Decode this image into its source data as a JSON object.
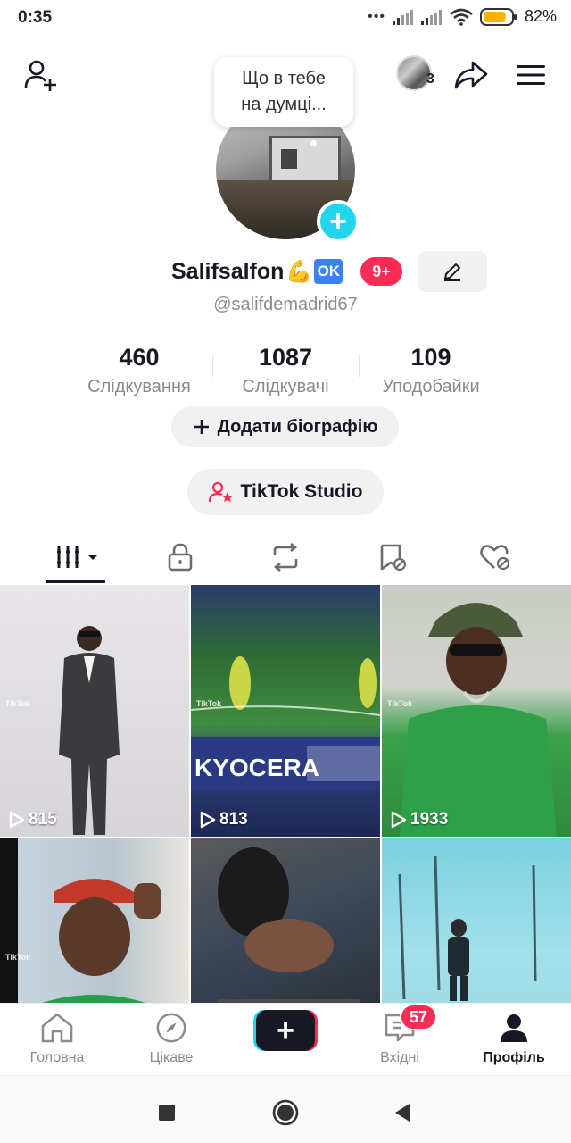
{
  "status_bar": {
    "time": "0:35",
    "battery_percent": "82%",
    "battery_level": 0.82,
    "icons": [
      "dots-icon",
      "signal-icon",
      "signal-icon",
      "wifi-icon",
      "battery-icon"
    ]
  },
  "top_bar": {
    "friends_count": "3"
  },
  "bubble": {
    "line1": "Що в тебе",
    "line2": "на думці..."
  },
  "profile": {
    "name": "Salifsalfon",
    "emoji": "💪",
    "ok_badge": "OK",
    "notif_badge": "9+",
    "handle": "@salifdemadrid67"
  },
  "stats": {
    "following_count": "460",
    "following_label": "Слідкування",
    "followers_count": "1087",
    "followers_label": "Слідкувачі",
    "likes_count": "109",
    "likes_label": "Уподобайки"
  },
  "buttons": {
    "add_bio": "Додати біографію",
    "studio": "TikTok Studio"
  },
  "tabs": [
    "videos-grid-icon",
    "lock-icon",
    "repost-icon",
    "favorites-icon",
    "liked-icon"
  ],
  "videos": [
    {
      "views": "815",
      "watermark": "TikTok"
    },
    {
      "views": "813",
      "watermark": "TikTok"
    },
    {
      "views": "1933",
      "watermark": "TikTok"
    },
    {
      "views": "",
      "watermark": "TikTok"
    },
    {
      "views": "",
      "watermark": ""
    },
    {
      "views": "",
      "watermark": ""
    }
  ],
  "bottom_nav": {
    "home": "Головна",
    "discover": "Цікаве",
    "inbox": "Вхідні",
    "inbox_badge": "57",
    "profile": "Профіль"
  },
  "colors": {
    "accent_red": "#fe2c55",
    "accent_cyan": "#20d5ec",
    "text_dark": "#161823",
    "text_muted": "#8a8b91"
  }
}
